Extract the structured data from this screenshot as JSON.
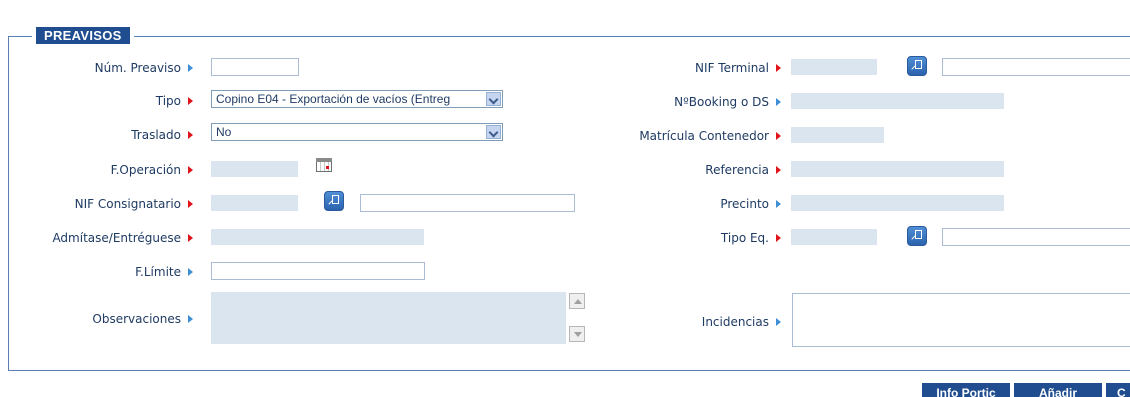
{
  "section": {
    "title": "PREAVISOS"
  },
  "left": {
    "num_preaviso": {
      "label": "Núm. Preaviso",
      "value": ""
    },
    "tipo": {
      "label": "Tipo",
      "selected": "Copino E04 - Exportación de vacíos (Entreg"
    },
    "traslado": {
      "label": "Traslado",
      "selected": "No"
    },
    "f_operacion": {
      "label": "F.Operación",
      "value": ""
    },
    "nif_consignatario": {
      "label": "NIF Consignatario",
      "value": "",
      "name_value": ""
    },
    "admitase": {
      "label": "Admítase/Entréguese",
      "value": ""
    },
    "f_limite": {
      "label": "F.Límite",
      "value": ""
    },
    "observaciones": {
      "label": "Observaciones",
      "value": ""
    }
  },
  "right": {
    "nif_terminal": {
      "label": "NIF Terminal",
      "value": "",
      "name_value": ""
    },
    "booking": {
      "label": "NºBooking o DS",
      "value": ""
    },
    "matricula": {
      "label": "Matrícula Contenedor",
      "value": ""
    },
    "referencia": {
      "label": "Referencia",
      "value": ""
    },
    "precinto": {
      "label": "Precinto",
      "value": ""
    },
    "tipo_eq": {
      "label": "Tipo Eq.",
      "value": "",
      "name_value": ""
    },
    "incidencias": {
      "label": "Incidencias",
      "value": ""
    }
  },
  "buttons": {
    "info_portic": "Info Portic",
    "anadir": "Añadir",
    "third": "C"
  },
  "colors": {
    "required_arrow": "#e0141b",
    "optional_arrow": "#3f8fd6",
    "legend_bg": "#1f4d8f",
    "readonly_bg": "#dbe5ef"
  }
}
